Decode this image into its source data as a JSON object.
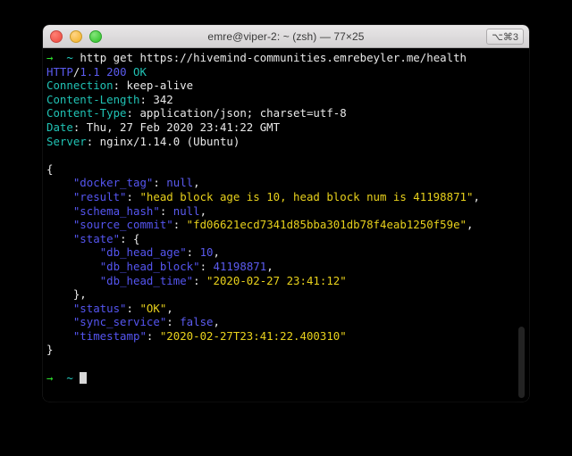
{
  "window": {
    "title": "emre@viper-2: ~ (zsh) — 77×25",
    "shortcut_badge": "⌥⌘3",
    "traffic_lights": {
      "close": "close-button",
      "minimize": "minimize-button",
      "maximize": "maximize-button"
    }
  },
  "terminal": {
    "prompt_arrow": "→",
    "prompt_path": "~",
    "command": "http get https://hivemind-communities.emrebeyler.me/health",
    "status_line": {
      "proto": "HTTP",
      "slash": "/",
      "version": "1.1",
      "code": "200",
      "reason": "OK"
    },
    "headers": [
      {
        "name": "Connection",
        "value": "keep-alive"
      },
      {
        "name": "Content-Length",
        "value": "342"
      },
      {
        "name": "Content-Type",
        "value": "application/json; charset=utf-8"
      },
      {
        "name": "Date",
        "value": "Thu, 27 Feb 2020 23:41:22 GMT"
      },
      {
        "name": "Server",
        "value": "nginx/1.14.0 (Ubuntu)"
      }
    ],
    "body": {
      "open_brace": "{",
      "close_brace": "}",
      "entries": [
        {
          "key": "\"docker_tag\"",
          "sep": ": ",
          "value": "null",
          "type": "null",
          "comma": ","
        },
        {
          "key": "\"result\"",
          "sep": ": ",
          "value": "\"head block age is 10, head block num is 41198871\"",
          "type": "string",
          "comma": ","
        },
        {
          "key": "\"schema_hash\"",
          "sep": ": ",
          "value": "null",
          "type": "null",
          "comma": ","
        },
        {
          "key": "\"source_commit\"",
          "sep": ": ",
          "value": "\"fd06621ecd7341d85bba301db78f4eab1250f59e\"",
          "type": "string",
          "comma": ","
        },
        {
          "key": "\"state\"",
          "sep": ": ",
          "value": "{",
          "type": "object-open",
          "comma": ""
        },
        {
          "key": "\"db_head_age\"",
          "sep": ": ",
          "value": "10",
          "type": "number",
          "comma": ",",
          "nested": true
        },
        {
          "key": "\"db_head_block\"",
          "sep": ": ",
          "value": "41198871",
          "type": "number",
          "comma": ",",
          "nested": true
        },
        {
          "key": "\"db_head_time\"",
          "sep": ": ",
          "value": "\"2020-02-27 23:41:12\"",
          "type": "string",
          "comma": "",
          "nested": true
        },
        {
          "key": "",
          "sep": "",
          "value": "},",
          "type": "object-close",
          "comma": ""
        },
        {
          "key": "\"status\"",
          "sep": ": ",
          "value": "\"OK\"",
          "type": "string",
          "comma": ","
        },
        {
          "key": "\"sync_service\"",
          "sep": ": ",
          "value": "false",
          "type": "bool",
          "comma": ","
        },
        {
          "key": "\"timestamp\"",
          "sep": ": ",
          "value": "\"2020-02-27T23:41:22.400310\"",
          "type": "string",
          "comma": ""
        }
      ]
    },
    "final_prompt": {
      "arrow": "→",
      "path": "~"
    }
  }
}
